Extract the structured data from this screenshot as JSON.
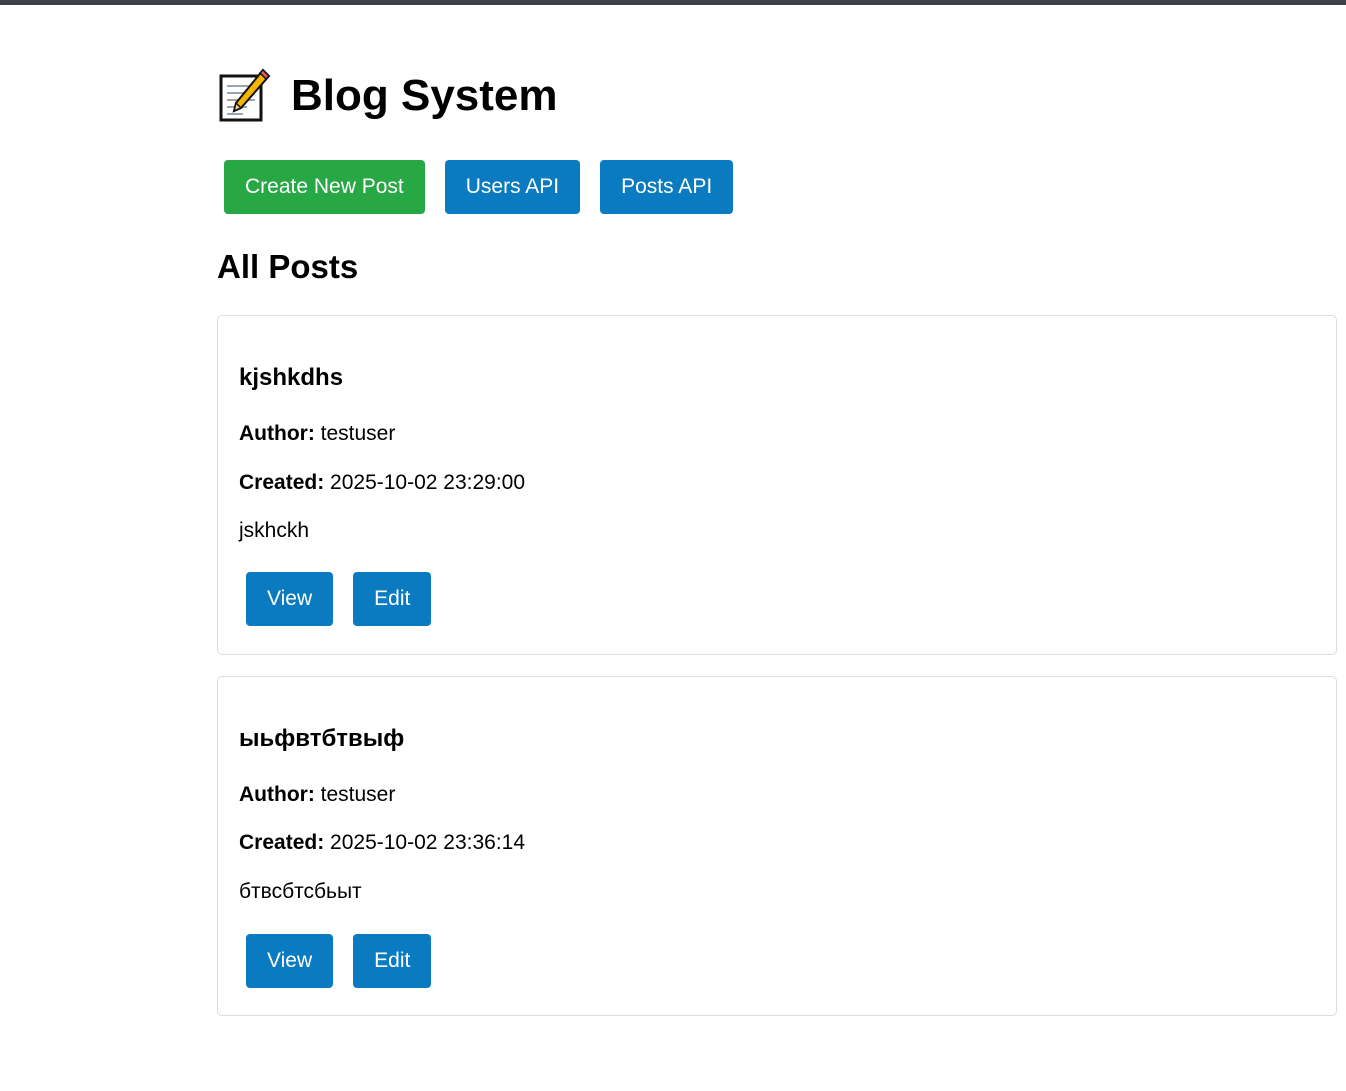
{
  "header": {
    "icon": "memo-icon",
    "title": "Blog System"
  },
  "nav": {
    "create_label": "Create New Post",
    "users_api_label": "Users API",
    "posts_api_label": "Posts API"
  },
  "section": {
    "title": "All Posts"
  },
  "labels": {
    "author": "Author:",
    "created": "Created:",
    "view": "View",
    "edit": "Edit"
  },
  "posts": [
    {
      "title": "kjshkdhs",
      "author": "testuser",
      "created": "2025-10-02 23:29:00",
      "content": "jskhckh"
    },
    {
      "title": "ыьфвтбтвыф",
      "author": "testuser",
      "created": "2025-10-02 23:36:14",
      "content": "бтвсбтсбьыт"
    }
  ],
  "colors": {
    "primary": "#0a7bc0",
    "success": "#28a745",
    "topbar": "#3c3f4a",
    "card_border": "#dddddd"
  }
}
